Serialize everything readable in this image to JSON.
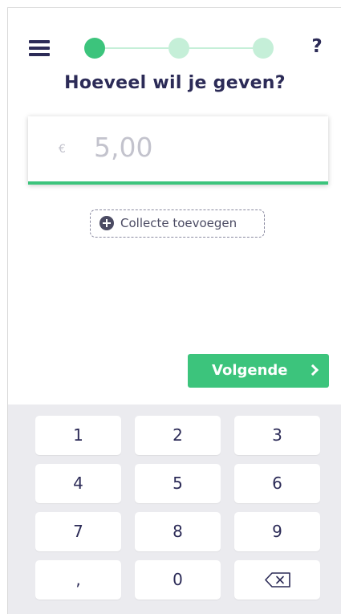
{
  "header": {
    "menu_icon": "hamburger-menu-icon",
    "steps": [
      {
        "state": "active"
      },
      {
        "state": "inactive"
      },
      {
        "state": "inactive"
      }
    ],
    "help_label": "?"
  },
  "main": {
    "title": "Hoeveel wil je geven?",
    "amount": {
      "currency_symbol": "€",
      "placeholder": "5,00",
      "value": ""
    },
    "add_collect_label": "Collecte toevoegen",
    "add_collect_icon": "plus-circle-icon"
  },
  "actions": {
    "next_label": "Volgende",
    "next_icon": "chevron-right-icon"
  },
  "keypad": {
    "keys": [
      "1",
      "2",
      "3",
      "4",
      "5",
      "6",
      "7",
      "8",
      "9",
      ",",
      "0"
    ],
    "backspace_icon": "backspace-icon"
  },
  "colors": {
    "primary_green": "#3cc47c",
    "light_green": "#c5efd8",
    "text_navy": "#2c2b57",
    "keypad_background": "#ebebef"
  }
}
